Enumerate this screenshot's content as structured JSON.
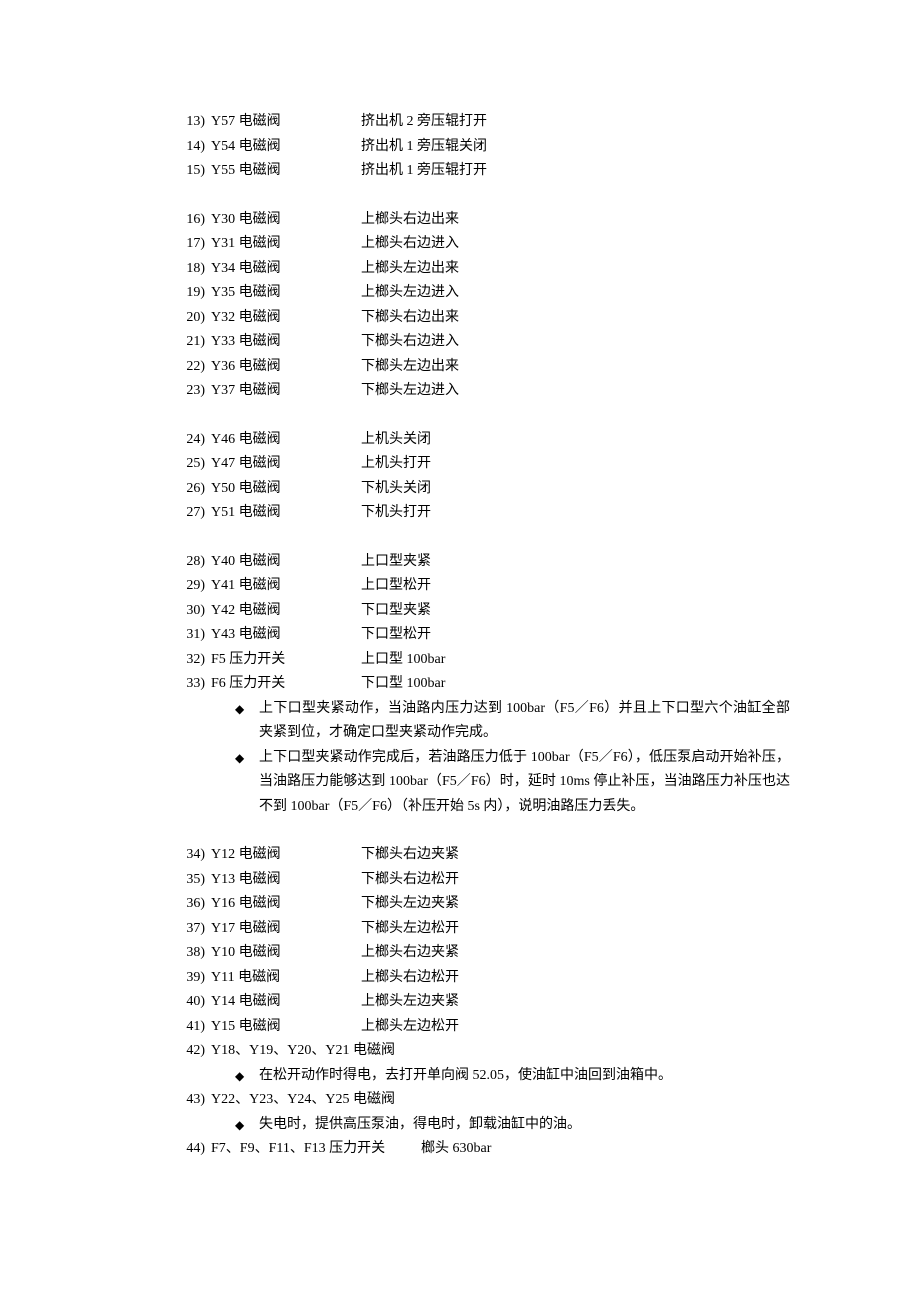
{
  "group1": [
    {
      "n": "13)",
      "l": "Y57 电磁阀",
      "d": "挤出机 2 旁压辊打开"
    },
    {
      "n": "14)",
      "l": "Y54 电磁阀",
      "d": "挤出机 1 旁压辊关闭"
    },
    {
      "n": "15)",
      "l": "Y55 电磁阀",
      "d": "挤出机 1 旁压辊打开"
    }
  ],
  "group2": [
    {
      "n": "16)",
      "l": "Y30 电磁阀",
      "d": "上榔头右边出来"
    },
    {
      "n": "17)",
      "l": "Y31 电磁阀",
      "d": "上榔头右边进入"
    },
    {
      "n": "18)",
      "l": "Y34 电磁阀",
      "d": "上榔头左边出来"
    },
    {
      "n": "19)",
      "l": "Y35 电磁阀",
      "d": "上榔头左边进入"
    },
    {
      "n": "20)",
      "l": "Y32 电磁阀",
      "d": "下榔头右边出来"
    },
    {
      "n": "21)",
      "l": "Y33 电磁阀",
      "d": "下榔头右边进入"
    },
    {
      "n": "22)",
      "l": "Y36 电磁阀",
      "d": "下榔头左边出来"
    },
    {
      "n": "23)",
      "l": "Y37 电磁阀",
      "d": "下榔头左边进入"
    }
  ],
  "group3": [
    {
      "n": "24)",
      "l": "Y46 电磁阀",
      "d": "上机头关闭"
    },
    {
      "n": "25)",
      "l": "Y47 电磁阀",
      "d": "上机头打开"
    },
    {
      "n": "26)",
      "l": "Y50 电磁阀",
      "d": "下机头关闭"
    },
    {
      "n": "27)",
      "l": "Y51 电磁阀",
      "d": "下机头打开"
    }
  ],
  "group4": [
    {
      "n": "28)",
      "l": "Y40 电磁阀",
      "d": "上口型夹紧"
    },
    {
      "n": "29)",
      "l": "Y41 电磁阀",
      "d": "上口型松开"
    },
    {
      "n": "30)",
      "l": "Y42 电磁阀",
      "d": "下口型夹紧"
    },
    {
      "n": "31)",
      "l": "Y43 电磁阀",
      "d": "下口型松开"
    },
    {
      "n": "32)",
      "l": "F5 压力开关",
      "d": "上口型 100bar"
    },
    {
      "n": "33)",
      "l": "F6 压力开关",
      "d": "下口型 100bar"
    }
  ],
  "bullets1": [
    "上下口型夹紧动作，当油路内压力达到 100bar（F5／F6）并且上下口型六个油缸全部夹紧到位，才确定口型夹紧动作完成。",
    "上下口型夹紧动作完成后，若油路压力低于 100bar（F5／F6），低压泵启动开始补压，当油路压力能够达到 100bar（F5／F6）时，延时 10ms 停止补压，当油路压力补压也达不到 100bar（F5／F6）（补压开始 5s 内），说明油路压力丢失。"
  ],
  "group5": [
    {
      "n": "34)",
      "l": "Y12 电磁阀",
      "d": "下榔头右边夹紧"
    },
    {
      "n": "35)",
      "l": "Y13 电磁阀",
      "d": "下榔头右边松开"
    },
    {
      "n": "36)",
      "l": "Y16 电磁阀",
      "d": "下榔头左边夹紧"
    },
    {
      "n": "37)",
      "l": "Y17 电磁阀",
      "d": "下榔头左边松开"
    },
    {
      "n": "38)",
      "l": "Y10 电磁阀",
      "d": "上榔头右边夹紧"
    },
    {
      "n": "39)",
      "l": "Y11 电磁阀",
      "d": "上榔头右边松开"
    },
    {
      "n": "40)",
      "l": "Y14 电磁阀",
      "d": "上榔头左边夹紧"
    },
    {
      "n": "41)",
      "l": "Y15 电磁阀",
      "d": "上榔头左边松开"
    }
  ],
  "line42": {
    "n": "42)",
    "l": "Y18、Y19、Y20、Y21 电磁阀"
  },
  "bullet42": "在松开动作时得电，去打开单向阀 52.05，使油缸中油回到油箱中。",
  "line43": {
    "n": "43)",
    "l": "Y22、Y23、Y24、Y25 电磁阀"
  },
  "bullet43": "失电时，提供高压泵油，得电时，卸载油缸中的油。",
  "line44": {
    "n": "44)",
    "l": "F7、F9、F11、F13 压力开关",
    "d": "榔头 630bar"
  },
  "diamond": "◆"
}
